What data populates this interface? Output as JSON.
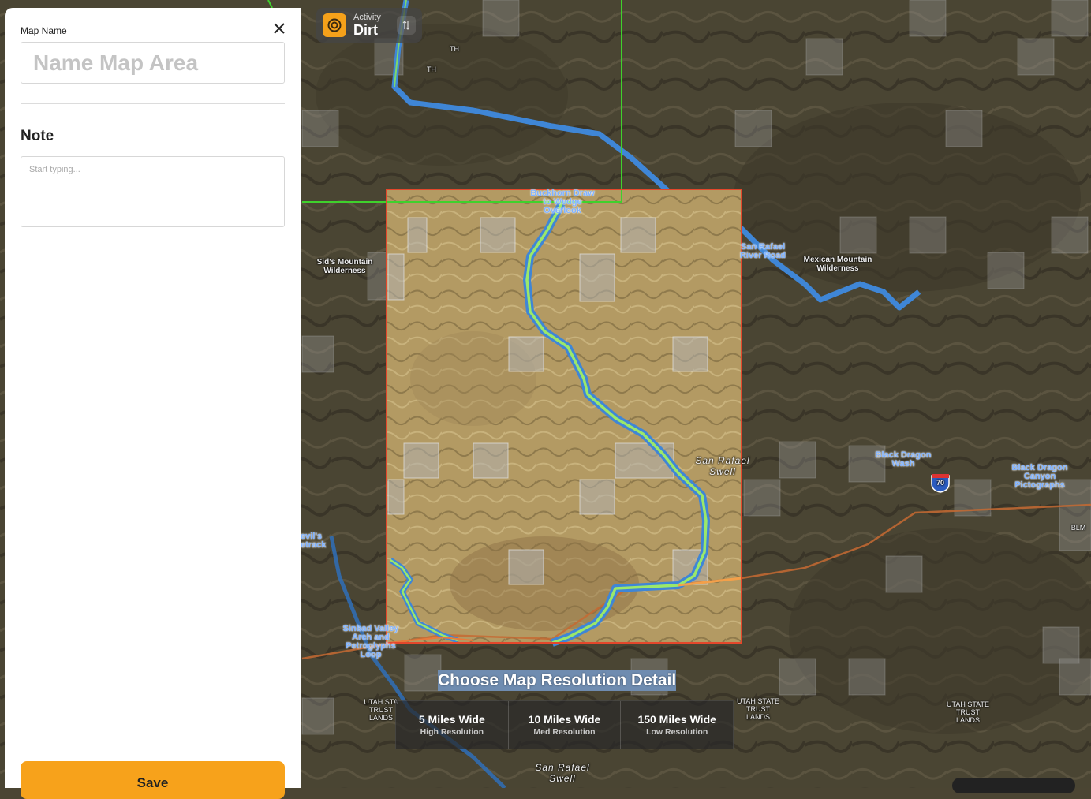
{
  "panel": {
    "map_name_label": "Map Name",
    "map_name_placeholder": "Name Map Area",
    "map_name_value": "",
    "note_label": "Note",
    "note_placeholder": "Start typing...",
    "note_value": "",
    "save_label": "Save"
  },
  "activity": {
    "label": "Activity",
    "value": "Dirt"
  },
  "resolution": {
    "title": "Choose Map Resolution Detail",
    "options": [
      {
        "main": "5 Miles Wide",
        "sub": "High Resolution"
      },
      {
        "main": "10 Miles Wide",
        "sub": "Med Resolution"
      },
      {
        "main": "150 Miles Wide",
        "sub": "Low Resolution"
      }
    ]
  },
  "map": {
    "labels": {
      "buckhorn": "Buckhorn Draw to Wedge Overlook",
      "san_rafael_river_road": "San Rafael River Road",
      "sids_mountain": "Sid's Mountain Wilderness",
      "mexican_mountain": "Mexican Mountain Wilderness",
      "san_rafael_swell_1": "San Rafael Swell",
      "san_rafael_swell_2": "San Rafael Swell",
      "black_dragon_wash": "Black Dragon Wash",
      "black_dragon_canyon": "Black Dragon Canyon Pictographs",
      "sinbad_valley": "Sinbad Valley Arch and Petroglyphs Loop",
      "devils_racetrack": "evil's etrack",
      "utah_trust_1": "UTAH STA TRUST LANDS",
      "utah_trust_2": "UTAH STATE TRUST LANDS",
      "utah_trust_3": "UTAH STATE TRUST LANDS",
      "th_1": "TH",
      "th_2": "TH",
      "blm": "BLM",
      "interstate": "70"
    },
    "colors": {
      "selection_border": "#e4472b",
      "trail_green": "#9be86a",
      "route_blue": "#3f86d6",
      "boundary_green": "#3fd12c",
      "road_orange": "#d9793a"
    }
  }
}
